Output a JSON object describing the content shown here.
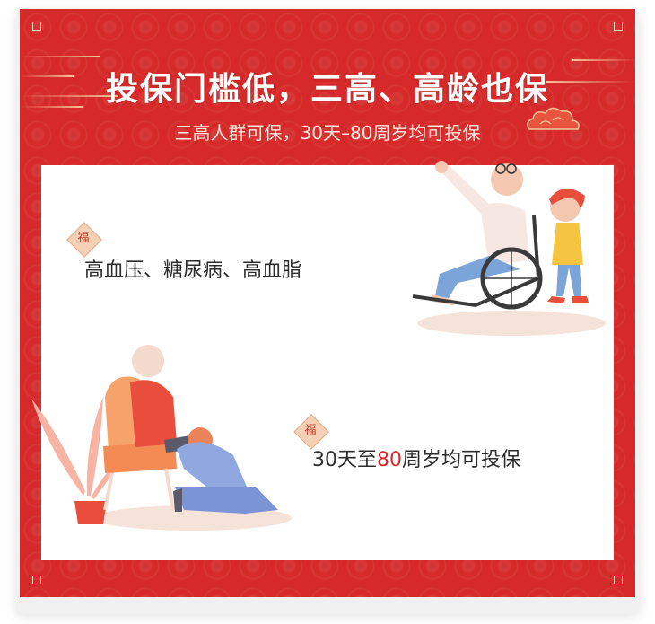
{
  "header": {
    "title": "投保门槛低，三高、高龄也保",
    "subtitle": "三高人群可保，30天–80周岁均可投保"
  },
  "badge_char": "福",
  "items": [
    {
      "text": "高血压、糖尿病、高血脂"
    },
    {
      "prefix": "30天至",
      "highlight": "80",
      "suffix": "周岁均可投保"
    }
  ],
  "colors": {
    "frame_red": "#d62a2a",
    "highlight_red": "#d62a2a",
    "text": "#2c2c2c",
    "gold": "#f4c396"
  },
  "icons": [
    "cloud-icon",
    "fu-badge-icon"
  ]
}
